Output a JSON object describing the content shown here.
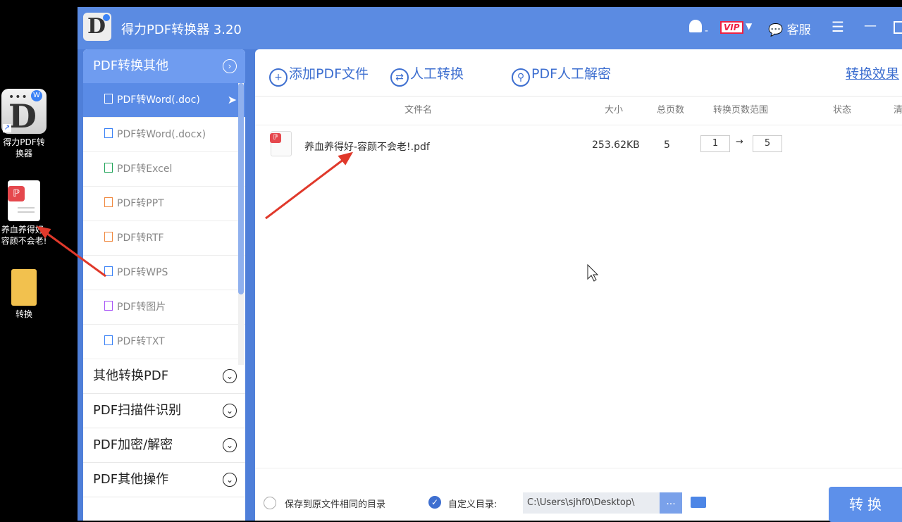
{
  "desktop": {
    "items": [
      {
        "label": "得力PDF转换器",
        "icon": "deli-pdf-app-icon"
      },
      {
        "label": "养血养得好-容颜不会老!",
        "icon": "pdf-file-icon"
      },
      {
        "label": "转换",
        "icon": "folder-icon"
      }
    ]
  },
  "window": {
    "title": "得力PDF转换器 3.20",
    "vip_label": "VIP",
    "service_label": "客服"
  },
  "sidebar": {
    "sections": [
      {
        "label": "PDF转换其他",
        "expanded": true,
        "items": [
          {
            "label": "PDF转Word(.doc)",
            "selected": true
          },
          {
            "label": "PDF转Word(.docx)"
          },
          {
            "label": "PDF转Excel"
          },
          {
            "label": "PDF转PPT"
          },
          {
            "label": "PDF转RTF"
          },
          {
            "label": "PDF转WPS"
          },
          {
            "label": "PDF转图片"
          },
          {
            "label": "PDF转TXT"
          }
        ]
      },
      {
        "label": "其他转换PDF"
      },
      {
        "label": "PDF扫描件识别"
      },
      {
        "label": "PDF加密/解密"
      },
      {
        "label": "PDF其他操作"
      }
    ]
  },
  "toolbar": {
    "add_pdf": "添加PDF文件",
    "manual_convert": "人工转换",
    "manual_decrypt": "PDF人工解密",
    "effect_link": "转换效果"
  },
  "table": {
    "headers": {
      "filename": "文件名",
      "size": "大小",
      "pages": "总页数",
      "range": "转换页数范围",
      "status": "状态",
      "clear": "清"
    },
    "rows": [
      {
        "filename": "养血养得好-容颜不会老!.pdf",
        "size": "253.62KB",
        "pages": "5",
        "range_from": "1",
        "range_to": "5"
      }
    ]
  },
  "bottom": {
    "save_same_dir": "保存到原文件相同的目录",
    "custom_dir": "自定义目录:",
    "path": "C:\\Users\\sjhf0\\Desktop\\",
    "browse": "...",
    "convert": "转换"
  },
  "colors": {
    "titlebar": "#5b8be2",
    "accent": "#3e6fd0",
    "selected": "#5a8be6",
    "annotation_arrow": "#e0392b"
  }
}
